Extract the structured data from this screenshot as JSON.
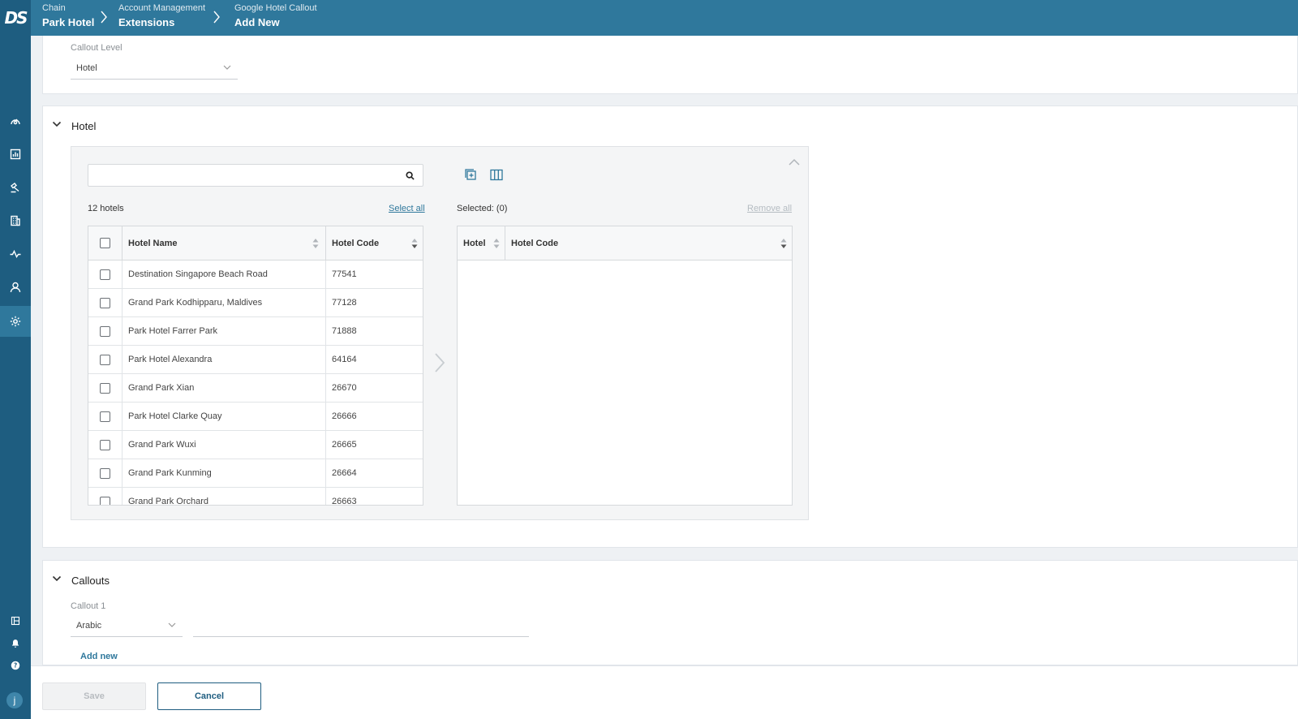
{
  "app": {
    "logo_text": "DS",
    "user_initial": "j"
  },
  "breadcrumb": [
    {
      "small": "Chain",
      "big": "Park Hotel"
    },
    {
      "small": "Account Management",
      "big": "Extensions"
    },
    {
      "small": "Google Hotel Callout",
      "big": "Add New"
    }
  ],
  "sidebar": {
    "icons": [
      "dashboard-icon",
      "analytics-icon",
      "auction-icon",
      "building-icon",
      "activity-icon",
      "user-icon",
      "gear-icon"
    ],
    "active": "gear-icon",
    "bottom_icons": [
      "panel-icon",
      "bell-icon",
      "help-icon"
    ]
  },
  "callout_level": {
    "label": "Callout Level",
    "value": "Hotel"
  },
  "hotel_section": {
    "title": "Hotel",
    "search": {
      "placeholder": "",
      "value": ""
    },
    "count_text": "12 hotels",
    "select_all": "Select all",
    "selected_text": "Selected: (0)",
    "remove_all": "Remove all",
    "left_columns": [
      "Hotel Name",
      "Hotel Code"
    ],
    "right_columns": [
      "Hotel",
      "Hotel Code"
    ],
    "rows": [
      {
        "name": "Destination Singapore Beach Road",
        "code": "77541"
      },
      {
        "name": "Grand Park Kodhipparu, Maldives",
        "code": "77128"
      },
      {
        "name": "Park Hotel Farrer Park",
        "code": "71888"
      },
      {
        "name": "Park Hotel Alexandra",
        "code": "64164"
      },
      {
        "name": "Grand Park Xian",
        "code": "26670"
      },
      {
        "name": "Park Hotel Clarke Quay",
        "code": "26666"
      },
      {
        "name": "Grand Park Wuxi",
        "code": "26665"
      },
      {
        "name": "Grand Park Kunming",
        "code": "26664"
      },
      {
        "name": "Grand Park Orchard",
        "code": "26663"
      }
    ]
  },
  "callouts_section": {
    "title": "Callouts",
    "callout_label": "Callout 1",
    "language": "Arabic",
    "text_value": "",
    "add_new": "Add new"
  },
  "footer": {
    "save": "Save",
    "cancel": "Cancel"
  },
  "colors": {
    "primary": "#2f789c",
    "sidebar": "#1e5d80"
  }
}
